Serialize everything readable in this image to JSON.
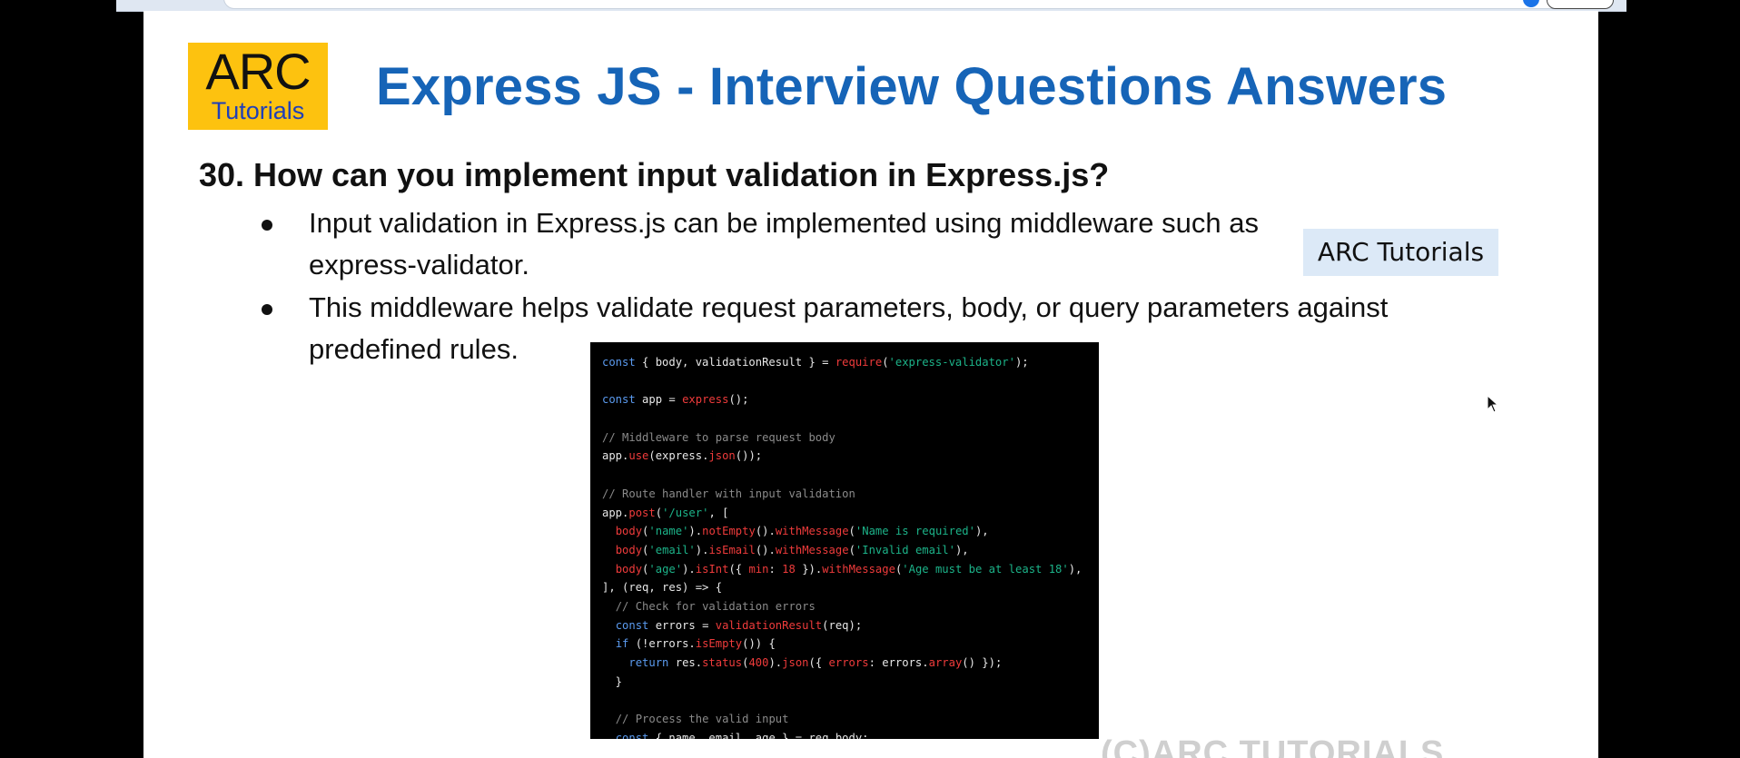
{
  "colors": {
    "title": "#1664b7",
    "logo_bg": "#fdc20f",
    "logo_sub": "#1f3fb8",
    "badge_bg": "#dce9f7",
    "code_bg": "#000000"
  },
  "logo": {
    "main": "ARC",
    "sub": "Tutorials"
  },
  "slide": {
    "title": "Express JS - Interview Questions Answers",
    "question": "30. How can you implement input validation in Express.js?",
    "bullets": [
      "Input validation in Express.js can be implemented using middleware such as express-validator.",
      "This middleware helps validate request parameters, body, or query parameters against predefined rules."
    ],
    "watermark_badge": "ARC Tutorials",
    "copyright": "(C)ARC TUTORIALS"
  },
  "code": {
    "lines": [
      [
        [
          "kw",
          "const"
        ],
        [
          "tx",
          " { body, validationResult } = "
        ],
        [
          "fn",
          "require"
        ],
        [
          "tx",
          "("
        ],
        [
          "str",
          "'express-validator'"
        ],
        [
          "tx",
          ");"
        ]
      ],
      [],
      [
        [
          "kw",
          "const"
        ],
        [
          "tx",
          " app = "
        ],
        [
          "fn",
          "express"
        ],
        [
          "tx",
          "();"
        ]
      ],
      [],
      [
        [
          "cm",
          "// Middleware to parse request body"
        ]
      ],
      [
        [
          "tx",
          "app."
        ],
        [
          "fn",
          "use"
        ],
        [
          "tx",
          "(express."
        ],
        [
          "fn",
          "json"
        ],
        [
          "tx",
          "());"
        ]
      ],
      [],
      [
        [
          "cm",
          "// Route handler with input validation"
        ]
      ],
      [
        [
          "tx",
          "app."
        ],
        [
          "fn",
          "post"
        ],
        [
          "tx",
          "("
        ],
        [
          "str",
          "'/user'"
        ],
        [
          "tx",
          ", ["
        ]
      ],
      [
        [
          "tx",
          "  "
        ],
        [
          "fn",
          "body"
        ],
        [
          "tx",
          "("
        ],
        [
          "str",
          "'name'"
        ],
        [
          "tx",
          ")."
        ],
        [
          "fn",
          "notEmpty"
        ],
        [
          "tx",
          "()."
        ],
        [
          "fn",
          "withMessage"
        ],
        [
          "tx",
          "("
        ],
        [
          "str",
          "'Name is required'"
        ],
        [
          "tx",
          "),"
        ]
      ],
      [
        [
          "tx",
          "  "
        ],
        [
          "fn",
          "body"
        ],
        [
          "tx",
          "("
        ],
        [
          "str",
          "'email'"
        ],
        [
          "tx",
          ")."
        ],
        [
          "fn",
          "isEmail"
        ],
        [
          "tx",
          "()."
        ],
        [
          "fn",
          "withMessage"
        ],
        [
          "tx",
          "("
        ],
        [
          "str",
          "'Invalid email'"
        ],
        [
          "tx",
          "),"
        ]
      ],
      [
        [
          "tx",
          "  "
        ],
        [
          "fn",
          "body"
        ],
        [
          "tx",
          "("
        ],
        [
          "str",
          "'age'"
        ],
        [
          "tx",
          ")."
        ],
        [
          "fn",
          "isInt"
        ],
        [
          "tx",
          "({ "
        ],
        [
          "fn",
          "min"
        ],
        [
          "tx",
          ": "
        ],
        [
          "num",
          "18"
        ],
        [
          "tx",
          " })."
        ],
        [
          "fn",
          "withMessage"
        ],
        [
          "tx",
          "("
        ],
        [
          "str",
          "'Age must be at least 18'"
        ],
        [
          "tx",
          "),"
        ]
      ],
      [
        [
          "tx",
          "], (req, res) => {"
        ]
      ],
      [
        [
          "tx",
          "  "
        ],
        [
          "cm",
          "// Check for validation errors"
        ]
      ],
      [
        [
          "tx",
          "  "
        ],
        [
          "kw",
          "const"
        ],
        [
          "tx",
          " errors = "
        ],
        [
          "fn",
          "validationResult"
        ],
        [
          "tx",
          "(req);"
        ]
      ],
      [
        [
          "tx",
          "  "
        ],
        [
          "kw",
          "if"
        ],
        [
          "tx",
          " (!errors."
        ],
        [
          "fn",
          "isEmpty"
        ],
        [
          "tx",
          "()) {"
        ]
      ],
      [
        [
          "tx",
          "    "
        ],
        [
          "kw",
          "return"
        ],
        [
          "tx",
          " res."
        ],
        [
          "fn",
          "status"
        ],
        [
          "tx",
          "("
        ],
        [
          "num",
          "400"
        ],
        [
          "tx",
          ")."
        ],
        [
          "fn",
          "json"
        ],
        [
          "tx",
          "({ "
        ],
        [
          "fn",
          "errors"
        ],
        [
          "tx",
          ": errors."
        ],
        [
          "fn",
          "array"
        ],
        [
          "tx",
          "() });"
        ]
      ],
      [
        [
          "tx",
          "  }"
        ]
      ],
      [],
      [
        [
          "tx",
          "  "
        ],
        [
          "cm",
          "// Process the valid input"
        ]
      ],
      [
        [
          "tx",
          "  "
        ],
        [
          "kw",
          "const"
        ],
        [
          "tx",
          " { name, email, age } = req.body;"
        ]
      ]
    ]
  }
}
